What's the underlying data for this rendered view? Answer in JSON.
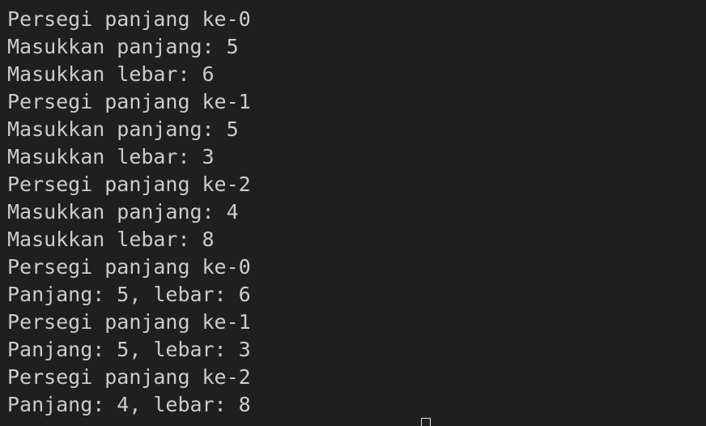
{
  "terminal": {
    "lines": [
      "Persegi panjang ke-0",
      "Masukkan panjang: 5",
      "Masukkan lebar: 6",
      "Persegi panjang ke-1",
      "Masukkan panjang: 5",
      "Masukkan lebar: 3",
      "Persegi panjang ke-2",
      "Masukkan panjang: 4",
      "Masukkan lebar: 8",
      "Persegi panjang ke-0",
      "Panjang: 5, lebar: 6",
      "Persegi panjang ke-1",
      "Panjang: 5, lebar: 3",
      "Persegi panjang ke-2",
      "Panjang: 4, lebar: 8"
    ],
    "colors": {
      "background": "#1f1f1f",
      "text": "#cccccc",
      "prompt_accent": "#3a96dd",
      "cursor": "#e6e6e6"
    }
  }
}
